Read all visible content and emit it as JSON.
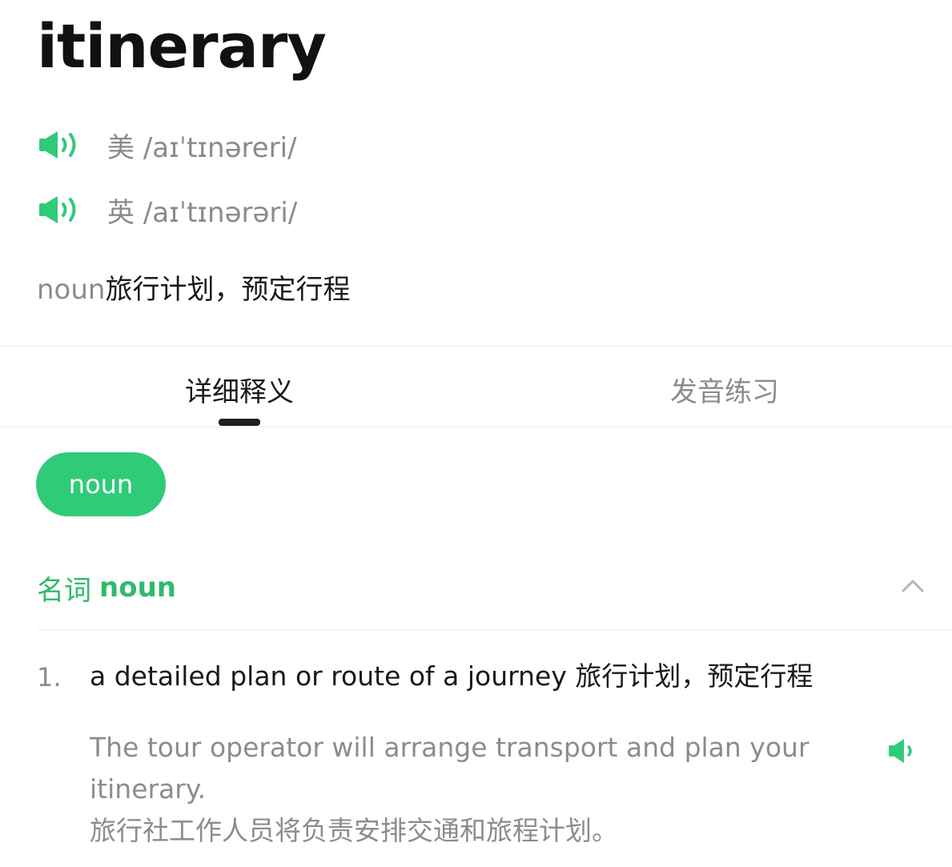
{
  "word": "itinerary",
  "pronunciations": [
    {
      "region": "美",
      "ipa": "/aɪˈtɪnəreri/",
      "icon": "speaker-icon"
    },
    {
      "region": "英",
      "ipa": "/aɪˈtɪnərəri/",
      "icon": "speaker-icon"
    }
  ],
  "summary": {
    "pos": "noun",
    "translation": "旅行计划，预定行程"
  },
  "tabs": [
    {
      "label": "详细释义",
      "active": true
    },
    {
      "label": "发音练习",
      "active": false
    }
  ],
  "pos_pill": "noun",
  "section": {
    "zh": "名词",
    "en": "noun",
    "chevron": "chevron-up-icon"
  },
  "definitions": [
    {
      "number": "1.",
      "text": "a detailed plan or route of a journey 旅行计划，预定行程",
      "example_en_line1": "The tour operator will arrange transport and plan your",
      "example_en_line2": "itinerary.",
      "example_zh": "旅行社工作人员将负责安排交通和旅程计划。"
    }
  ],
  "colors": {
    "accent": "#2fcb78",
    "accent_text": "#2fba6d",
    "muted": "#8c8c8c"
  }
}
